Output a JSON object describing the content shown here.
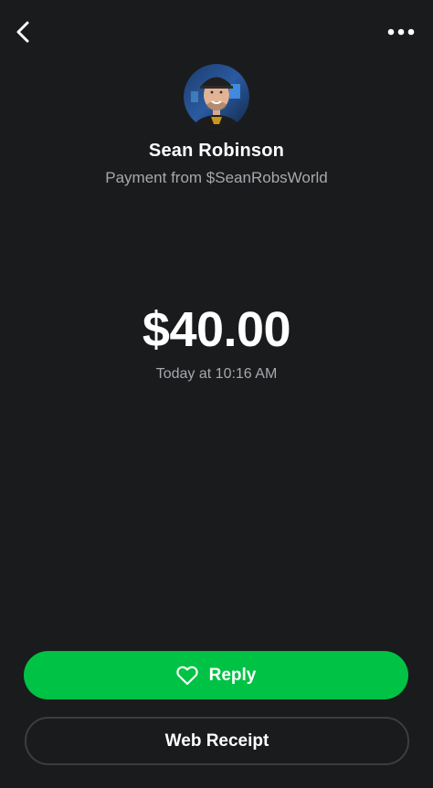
{
  "header": {
    "back_icon": "chevron-left-icon",
    "more_icon": "more-horizontal-icon"
  },
  "sender": {
    "name": "Sean Robinson",
    "subtitle": "Payment from $SeanRobsWorld",
    "avatar_icon": "avatar-photo"
  },
  "payment": {
    "amount": "$40.00",
    "timestamp": "Today at 10:16 AM"
  },
  "actions": {
    "reply_label": "Reply",
    "reply_icon": "heart-outline-icon",
    "web_receipt_label": "Web Receipt"
  },
  "colors": {
    "background": "#1a1b1d",
    "accent_green": "#00c244",
    "secondary_text": "#a6a8ac",
    "button_border": "#3c3d40"
  }
}
